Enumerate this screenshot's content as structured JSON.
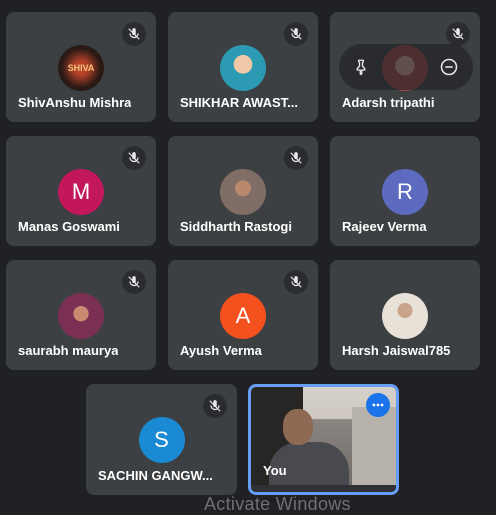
{
  "participants": [
    {
      "name": "ShivAnshu Mishra",
      "avatar": "shiva-logo",
      "muted": true
    },
    {
      "name": "SHIKHAR AWAST...",
      "avatar": "photo",
      "muted": true
    },
    {
      "name": "Adarsh tripathi",
      "avatar": "photo",
      "muted": true
    },
    {
      "name": "Manas Goswami",
      "avatar_letter": "M",
      "avatar_color": "#c2185b",
      "muted": true
    },
    {
      "name": "Siddharth Rastogi",
      "avatar": "photo",
      "muted": true
    },
    {
      "name": "Rajeev Verma",
      "avatar_letter": "R",
      "avatar_color": "#5c6bc0",
      "muted": false
    },
    {
      "name": "saurabh maurya",
      "avatar": "photo",
      "muted": true
    },
    {
      "name": "Ayush Verma",
      "avatar_letter": "A",
      "avatar_color": "#f4511e",
      "muted": true
    },
    {
      "name": "Harsh Jaiswal785",
      "avatar": "photo",
      "muted": false
    },
    {
      "name": "SACHIN GANGW...",
      "avatar_letter": "S",
      "avatar_color": "#1a8ad4",
      "muted": true
    }
  ],
  "shiva_logo_text": "SHIVA",
  "self_tile": {
    "label": "You",
    "more_icon": "more-horizontal-icon"
  },
  "hover_controls": {
    "pin_icon": "pin-icon",
    "remove_icon": "remove-icon"
  },
  "watermark": "Activate Windows",
  "colors": {
    "background": "#202124",
    "tile": "#3c4043",
    "accent": "#669df6"
  }
}
